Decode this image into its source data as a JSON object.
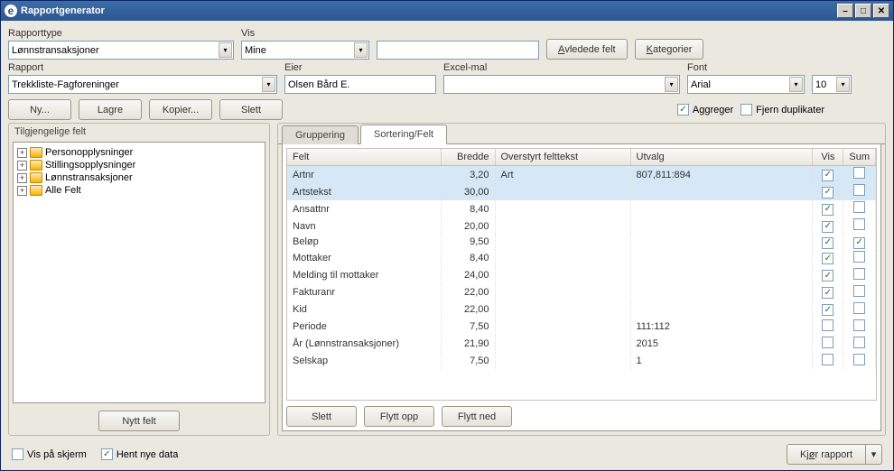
{
  "window_title": "Rapportgenerator",
  "labels": {
    "rapporttype": "Rapporttype",
    "vis": "Vis",
    "rapport": "Rapport",
    "eier": "Eier",
    "excelmal": "Excel-mal",
    "font": "Font",
    "tilgjengelige_felt": "Tilgjengelige felt"
  },
  "values": {
    "rapporttype": "Lønnstransaksjoner",
    "vis": "Mine",
    "filter": "",
    "rapport": "Trekkliste-Fagforeninger",
    "eier": "Olsen Bård E.",
    "excelmal": "",
    "font": "Arial",
    "fontsize": "10"
  },
  "buttons": {
    "avledede_felt": "Avledede felt",
    "kategorier": "Kategorier",
    "ny": "Ny...",
    "lagre": "Lagre",
    "kopier": "Kopier...",
    "slett": "Slett",
    "nytt_felt": "Nytt felt",
    "flytt_opp": "Flytt opp",
    "flytt_ned": "Flytt ned",
    "kjor_rapport": "Kjør rapport"
  },
  "checkboxes": {
    "aggreger": {
      "label": "Aggreger",
      "checked": true
    },
    "fjern_duplikater": {
      "label": "Fjern duplikater",
      "checked": false
    },
    "vis_pa_skjerm": {
      "label": "Vis på skjerm",
      "checked": false
    },
    "hent_nye_data": {
      "label": "Hent nye data",
      "checked": true
    }
  },
  "tree": [
    {
      "label": "Personopplysninger"
    },
    {
      "label": "Stillingsopplysninger"
    },
    {
      "label": "Lønnstransaksjoner"
    },
    {
      "label": "Alle Felt"
    }
  ],
  "tabs": [
    {
      "label": "Gruppering",
      "active": false
    },
    {
      "label": "Sortering/Felt",
      "active": true
    }
  ],
  "grid": {
    "headers": {
      "felt": "Felt",
      "bredde": "Bredde",
      "overstyrt": "Overstyrt felttekst",
      "utvalg": "Utvalg",
      "vis": "Vis",
      "sum": "Sum"
    },
    "rows": [
      {
        "felt": "Artnr",
        "bredde": "3,20",
        "overstyrt": "Art",
        "utvalg": "807,811:894",
        "vis": true,
        "sum": false,
        "sel": true
      },
      {
        "felt": "Artstekst",
        "bredde": "30,00",
        "overstyrt": "",
        "utvalg": "",
        "vis": true,
        "sum": false,
        "sel": true
      },
      {
        "felt": "Ansattnr",
        "bredde": "8,40",
        "overstyrt": "",
        "utvalg": "",
        "vis": true,
        "sum": false
      },
      {
        "felt": "Navn",
        "bredde": "20,00",
        "overstyrt": "",
        "utvalg": "",
        "vis": true,
        "sum": false
      },
      {
        "felt": "Beløp",
        "bredde": "9,50",
        "overstyrt": "",
        "utvalg": "",
        "vis": true,
        "sum": true
      },
      {
        "felt": "Mottaker",
        "bredde": "8,40",
        "overstyrt": "",
        "utvalg": "",
        "vis": true,
        "sum": false
      },
      {
        "felt": "Melding til mottaker",
        "bredde": "24,00",
        "overstyrt": "",
        "utvalg": "",
        "vis": true,
        "sum": false
      },
      {
        "felt": "Fakturanr",
        "bredde": "22,00",
        "overstyrt": "",
        "utvalg": "",
        "vis": true,
        "sum": false
      },
      {
        "felt": "Kid",
        "bredde": "22,00",
        "overstyrt": "",
        "utvalg": "",
        "vis": true,
        "sum": false
      },
      {
        "felt": "Periode",
        "bredde": "7,50",
        "overstyrt": "",
        "utvalg": "111:112",
        "vis": false,
        "sum": false
      },
      {
        "felt": "År (Lønnstransaksjoner)",
        "bredde": "21,90",
        "overstyrt": "",
        "utvalg": "2015",
        "vis": false,
        "sum": false
      },
      {
        "felt": "Selskap",
        "bredde": "7,50",
        "overstyrt": "",
        "utvalg": "1",
        "vis": false,
        "sum": false
      }
    ]
  }
}
